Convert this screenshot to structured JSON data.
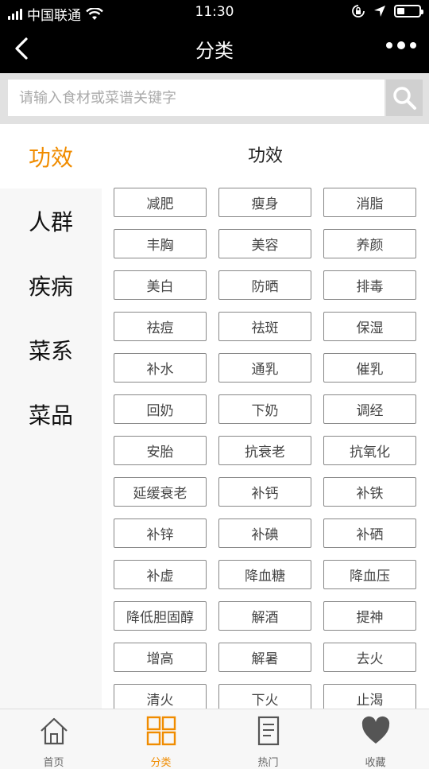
{
  "status": {
    "carrier": "中国联通",
    "time": "11:30",
    "battery_level": 0.35
  },
  "nav": {
    "title": "分类"
  },
  "search": {
    "placeholder": "请输入食材或菜谱关键字"
  },
  "sidebar": {
    "items": [
      {
        "label": "功效",
        "active": true
      },
      {
        "label": "人群",
        "active": false
      },
      {
        "label": "疾病",
        "active": false
      },
      {
        "label": "菜系",
        "active": false
      },
      {
        "label": "菜品",
        "active": false
      }
    ]
  },
  "main": {
    "section_title": "功效",
    "tags": [
      "减肥",
      "瘦身",
      "消脂",
      "丰胸",
      "美容",
      "养颜",
      "美白",
      "防晒",
      "排毒",
      "祛痘",
      "祛斑",
      "保湿",
      "补水",
      "通乳",
      "催乳",
      "回奶",
      "下奶",
      "调经",
      "安胎",
      "抗衰老",
      "抗氧化",
      "延缓衰老",
      "补钙",
      "补铁",
      "补锌",
      "补碘",
      "补硒",
      "补虚",
      "降血糖",
      "降血压",
      "降低胆固醇",
      "解酒",
      "提神",
      "增高",
      "解暑",
      "去火",
      "清火",
      "下火",
      "止渴"
    ]
  },
  "tabbar": {
    "items": [
      {
        "label": "首页",
        "icon": "home-icon",
        "active": false
      },
      {
        "label": "分类",
        "icon": "grid-icon",
        "active": true
      },
      {
        "label": "热门",
        "icon": "document-icon",
        "active": false
      },
      {
        "label": "收藏",
        "icon": "heart-icon",
        "active": false
      }
    ]
  },
  "colors": {
    "accent": "#f08c00",
    "bar": "#000000"
  }
}
